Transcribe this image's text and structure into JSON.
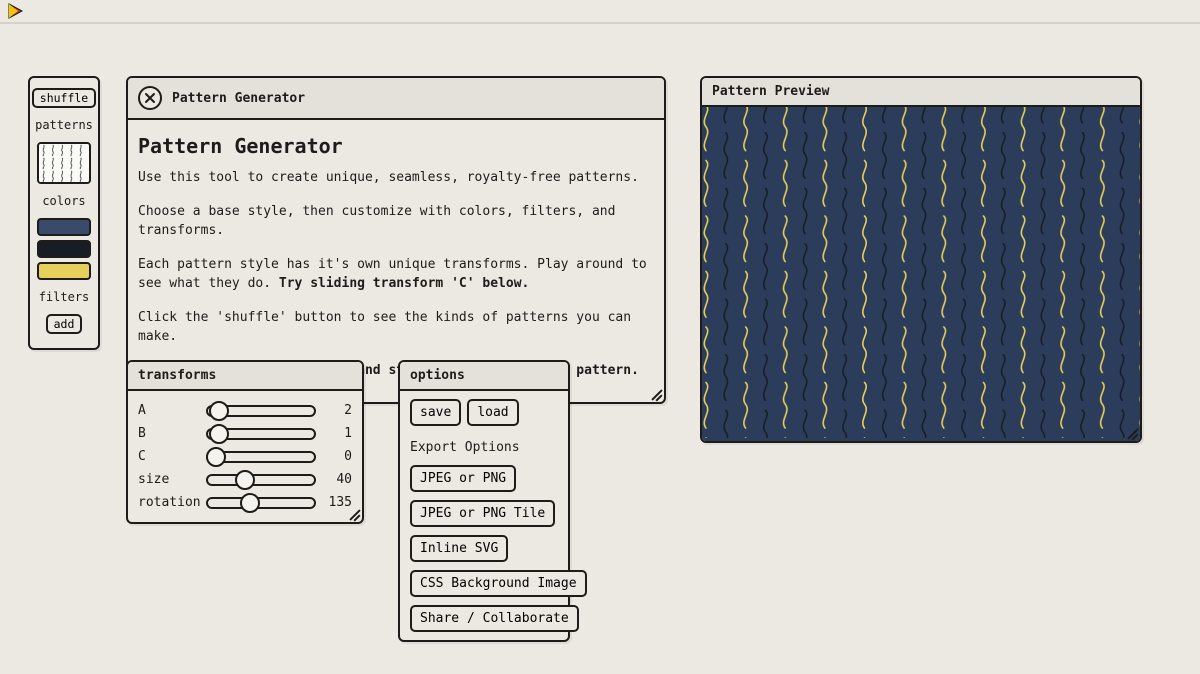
{
  "sidebar": {
    "shuffle_label": "shuffle",
    "patterns_label": "patterns",
    "colors_label": "colors",
    "filters_label": "filters",
    "add_label": "add",
    "swatches": [
      "#3a4a6b",
      "#181c25",
      "#e6cf5b"
    ]
  },
  "intro": {
    "header": "Pattern Generator",
    "title": "Pattern Generator",
    "p1": "Use this tool to create unique, seamless, royalty-free patterns.",
    "p2": "Choose a base style, then customize with colors, filters, and transforms.",
    "p3a": "Each pattern style has it's own unique transforms. Play around to see what they do. ",
    "p3b": "Try sliding transform 'C' below.",
    "p4": "Click the 'shuffle' button to see the kinds of patterns you can make.",
    "p5": "Click 'X' to close this box and start creating your own pattern."
  },
  "transforms": {
    "header": "transforms",
    "rows": [
      {
        "label": "A",
        "value": "2",
        "pct": 10
      },
      {
        "label": "B",
        "value": "1",
        "pct": 10
      },
      {
        "label": "C",
        "value": "0",
        "pct": 8
      },
      {
        "label": "size",
        "value": "40",
        "pct": 35
      },
      {
        "label": "rotation",
        "value": "135",
        "pct": 40
      }
    ]
  },
  "options": {
    "header": "options",
    "save": "save",
    "load": "load",
    "export_title": "Export Options",
    "buttons": [
      "JPEG or PNG",
      "JPEG or PNG Tile",
      "Inline SVG",
      "CSS Background Image",
      "Share / Collaborate"
    ]
  },
  "preview": {
    "header": "Pattern Preview",
    "bg": "#2c3d5c",
    "squiggle_yellow": "#e6cf5b",
    "squiggle_dark": "#181c25"
  }
}
